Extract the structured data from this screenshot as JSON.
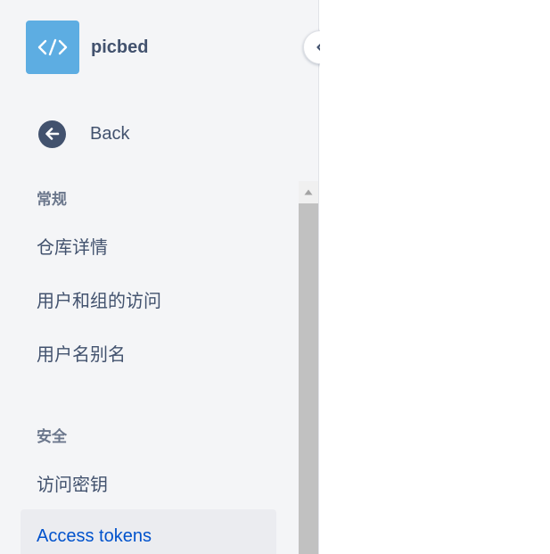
{
  "repo": {
    "name": "picbed",
    "logo_icon": "code-brackets-icon",
    "logo_color": "#5dade2"
  },
  "nav": {
    "back_label": "Back",
    "sections": [
      {
        "title": "常规",
        "items": [
          {
            "label": "仓库详情"
          },
          {
            "label": "用户和组的访问"
          },
          {
            "label": "用户名别名"
          }
        ]
      },
      {
        "title": "安全",
        "items": [
          {
            "label": "访问密钥"
          },
          {
            "label": "Access tokens",
            "active": true
          }
        ]
      }
    ]
  },
  "colors": {
    "sidebar_bg": "#f4f5f7",
    "accent": "#0052cc",
    "text": "#42526e",
    "muted": "#6b778c",
    "active_bg": "#ebecf0"
  }
}
